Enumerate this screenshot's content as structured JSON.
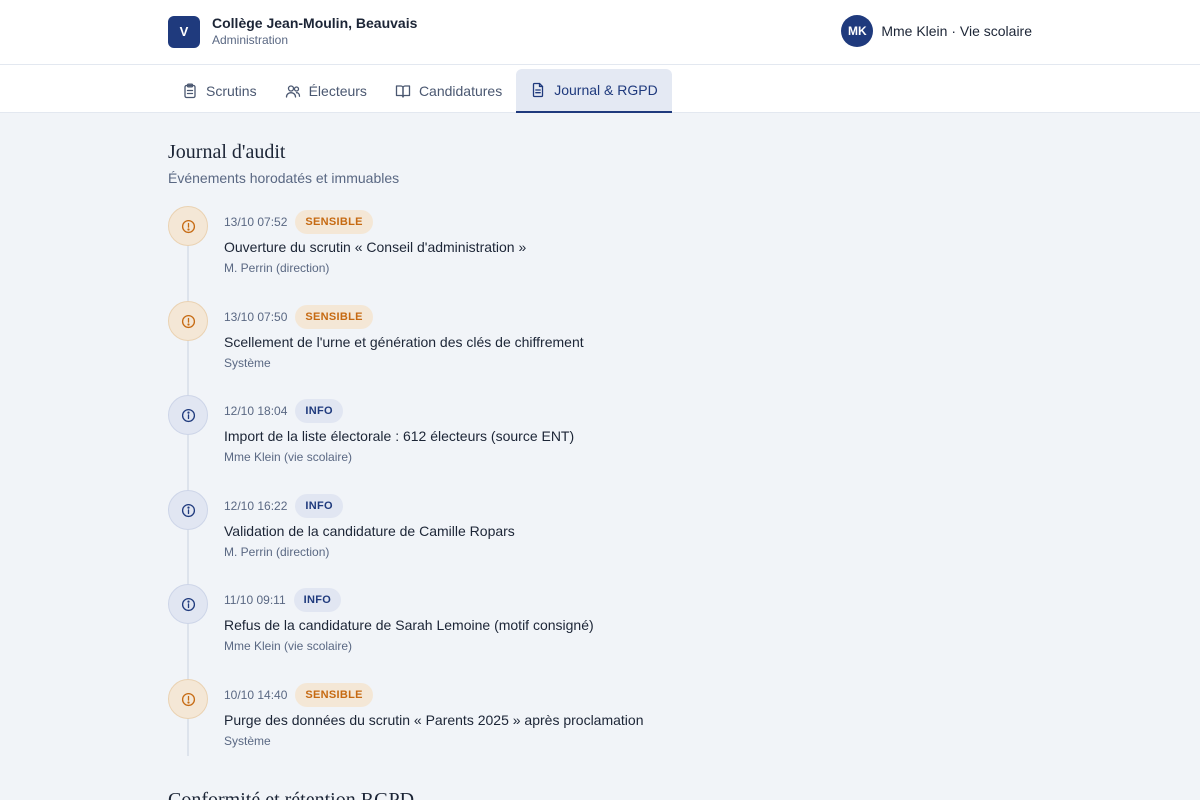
{
  "header": {
    "logo_letter": "V",
    "school_name": "Collège Jean-Moulin, Beauvais",
    "school_sub": "Administration",
    "user_initials": "MK",
    "user_label": "Mme Klein · Vie scolaire"
  },
  "tabs": [
    {
      "label": "Scrutins",
      "icon": "clipboard-icon",
      "active": false
    },
    {
      "label": "Électeurs",
      "icon": "users-icon",
      "active": false
    },
    {
      "label": "Candidatures",
      "icon": "book-icon",
      "active": false
    },
    {
      "label": "Journal & RGPD",
      "icon": "document-icon",
      "active": true
    }
  ],
  "audit": {
    "title": "Journal d'audit",
    "subtitle": "Événements horodatés et immuables",
    "events": [
      {
        "time": "13/10 07:52",
        "level": "sensible",
        "badge": "SENSIBLE",
        "description": "Ouverture du scrutin « Conseil d'administration »",
        "author": "M. Perrin (direction)",
        "icon": "alert-circle-icon"
      },
      {
        "time": "13/10 07:50",
        "level": "sensible",
        "badge": "SENSIBLE",
        "description": "Scellement de l'urne et génération des clés de chiffrement",
        "author": "Système",
        "icon": "alert-circle-icon"
      },
      {
        "time": "12/10 18:04",
        "level": "info",
        "badge": "INFO",
        "description": "Import de la liste électorale : 612 électeurs (source ENT)",
        "author": "Mme Klein (vie scolaire)",
        "icon": "info-circle-icon"
      },
      {
        "time": "12/10 16:22",
        "level": "info",
        "badge": "INFO",
        "description": "Validation de la candidature de Camille Ropars",
        "author": "M. Perrin (direction)",
        "icon": "info-circle-icon"
      },
      {
        "time": "11/10 09:11",
        "level": "info",
        "badge": "INFO",
        "description": "Refus de la candidature de Sarah Lemoine (motif consigné)",
        "author": "Mme Klein (vie scolaire)",
        "icon": "info-circle-icon"
      },
      {
        "time": "10/10 14:40",
        "level": "sensible",
        "badge": "SENSIBLE",
        "description": "Purge des données du scrutin « Parents 2025 » après proclamation",
        "author": "Système",
        "icon": "alert-circle-icon"
      }
    ]
  },
  "rgpd": {
    "title": "Conformité et rétention RGPD"
  },
  "colors": {
    "primary": "#1f3a7d",
    "sensible": "#c66a12",
    "background": "#f1f4f8"
  }
}
